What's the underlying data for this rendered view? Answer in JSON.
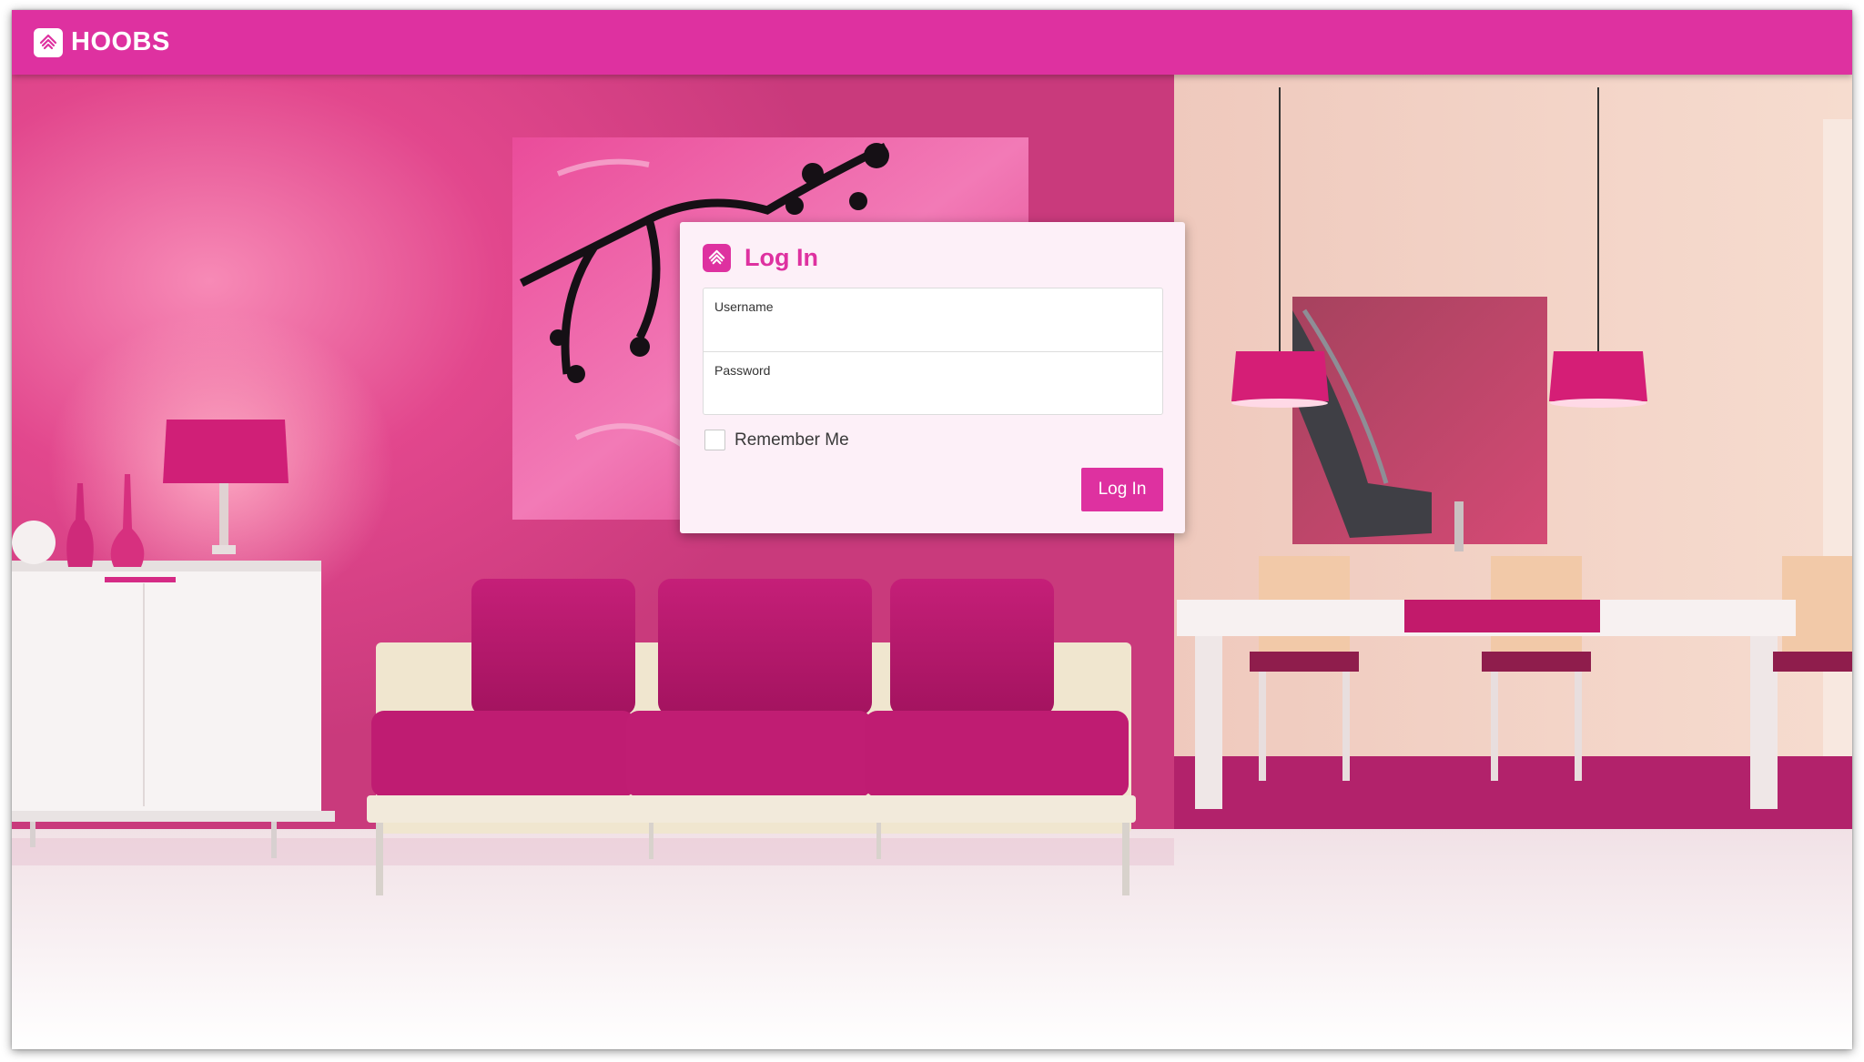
{
  "app": {
    "brand": "HOOBS",
    "brand_icon": "hoobs-logo-icon"
  },
  "login": {
    "title": "Log In",
    "username_label": "Username",
    "username_value": "",
    "password_label": "Password",
    "password_value": "",
    "remember_label": "Remember Me",
    "remember_checked": false,
    "submit_label": "Log In"
  },
  "colors": {
    "accent": "#de31a0",
    "card_background": "#fdf0f8"
  }
}
